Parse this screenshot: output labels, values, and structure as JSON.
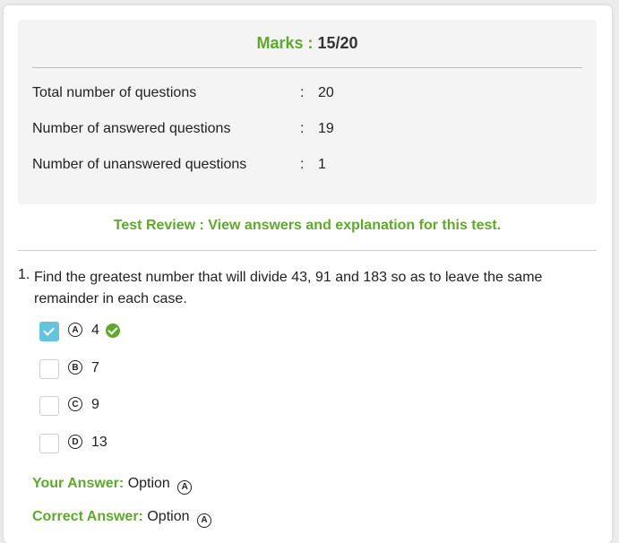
{
  "summary": {
    "marks_label": "Marks :",
    "marks_value": "15/20",
    "stats": [
      {
        "label": "Total number of questions",
        "value": "20"
      },
      {
        "label": "Number of answered questions",
        "value": "19"
      },
      {
        "label": "Number of unanswered questions",
        "value": "1"
      }
    ],
    "colon": ":"
  },
  "review_link": "Test Review : View answers and explanation for this test.",
  "question": {
    "number": "1.",
    "text": "Find the greatest number that will divide 43, 91 and 183 so as to leave the same remainder in each case.",
    "options": [
      {
        "letter": "A",
        "text": "4",
        "checked": true,
        "correct": true
      },
      {
        "letter": "B",
        "text": "7",
        "checked": false,
        "correct": false
      },
      {
        "letter": "C",
        "text": "9",
        "checked": false,
        "correct": false
      },
      {
        "letter": "D",
        "text": "13",
        "checked": false,
        "correct": false
      }
    ],
    "your_answer_label": "Your Answer:",
    "your_answer_text": "Option",
    "your_answer_letter": "A",
    "correct_answer_label": "Correct Answer:",
    "correct_answer_text": "Option",
    "correct_answer_letter": "A"
  },
  "colors": {
    "accent_green": "#5fa82d",
    "checked_blue": "#65c3de"
  }
}
